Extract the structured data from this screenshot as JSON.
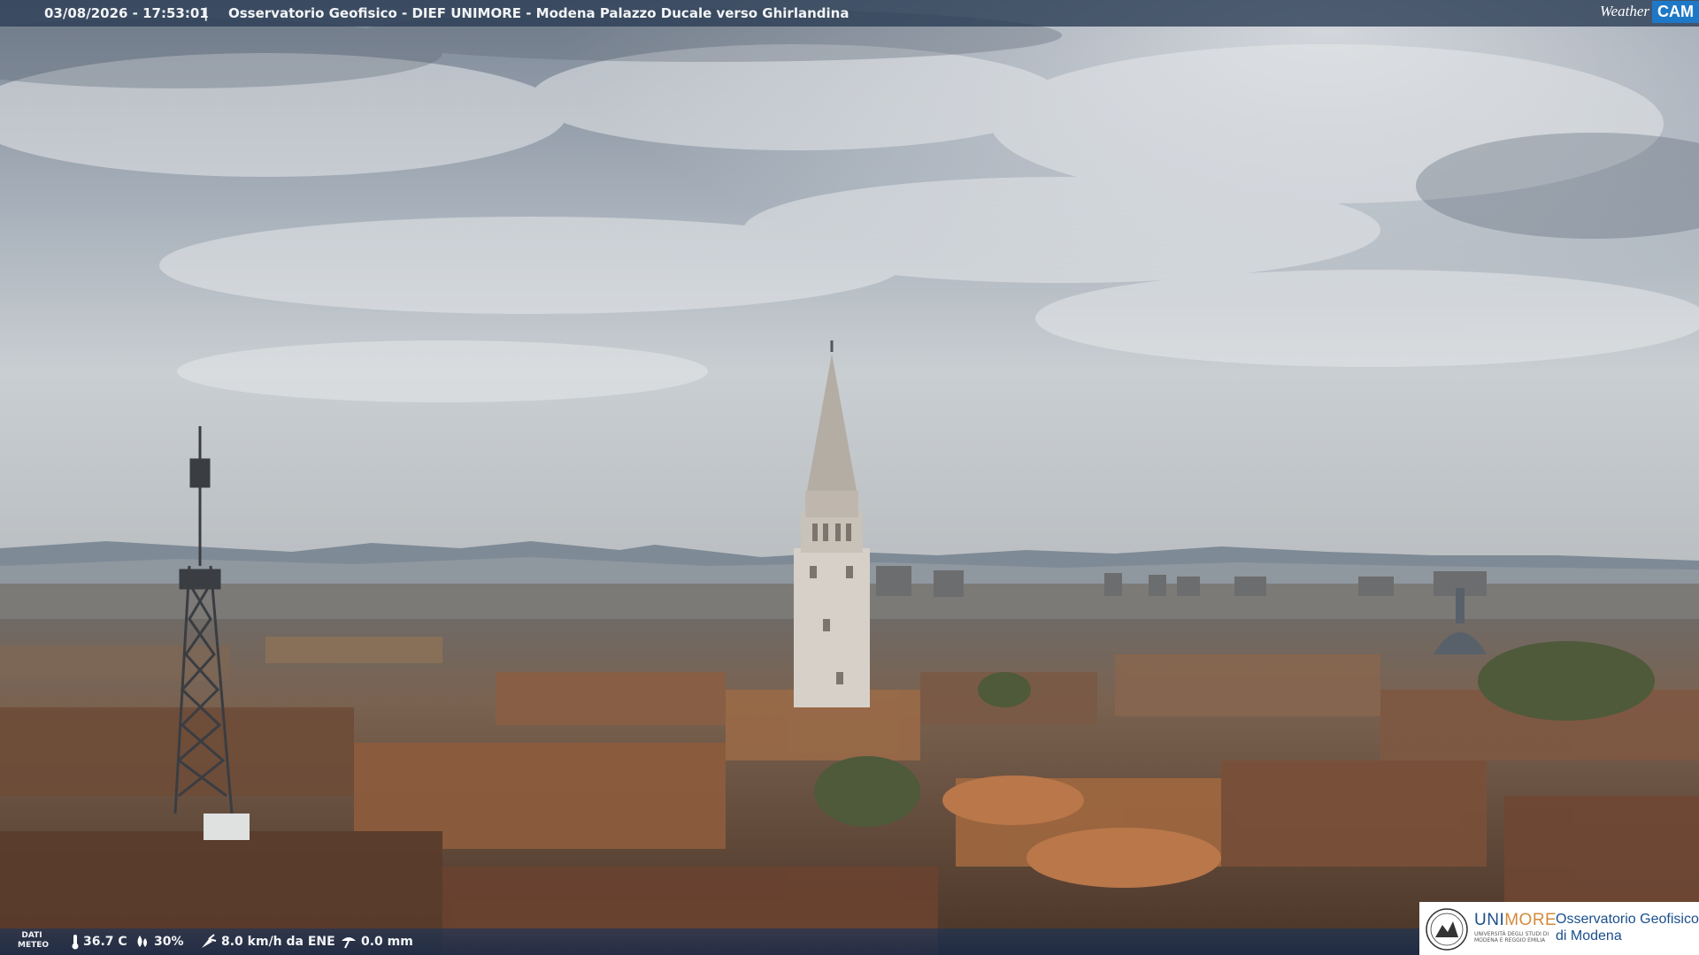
{
  "header": {
    "datetime": "03/08/2026 - 17:53:01",
    "separator": "|",
    "title": "Osservatorio Geofisico - DIEF UNIMORE - Modena Palazzo Ducale verso Ghirlandina"
  },
  "brand": {
    "weather": "Weather",
    "cam": "CAM",
    "cam_color": "#1e78c8"
  },
  "meteo": {
    "label_line1": "DATI",
    "label_line2": "METEO",
    "temperature": "36.7 C",
    "humidity": "30%",
    "wind": "8.0 km/h da ENE",
    "rain": "0.0 mm",
    "icons": [
      "thermometer-icon",
      "humidity-icon",
      "wind-icon",
      "rain-gauge-icon"
    ]
  },
  "logo": {
    "uni_a": "UNI",
    "uni_b": "MORE",
    "uni_sub": "UNIVERSITÀ DEGLI STUDI DI MODENA E REGGIO EMILIA",
    "obs_line1": "Osservatorio Geofisico",
    "obs_line2": "di Modena",
    "uni_color": "#1a4f8c",
    "more_color": "#d38b3b"
  }
}
